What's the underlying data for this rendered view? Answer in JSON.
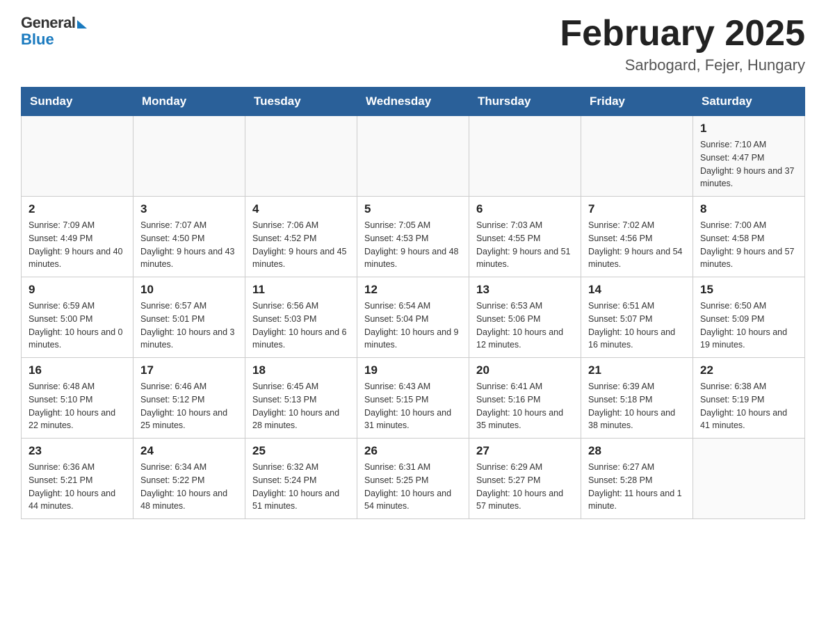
{
  "logo": {
    "general": "General",
    "blue": "Blue"
  },
  "header": {
    "month_year": "February 2025",
    "location": "Sarbogard, Fejer, Hungary"
  },
  "days_of_week": [
    "Sunday",
    "Monday",
    "Tuesday",
    "Wednesday",
    "Thursday",
    "Friday",
    "Saturday"
  ],
  "weeks": [
    [
      {
        "day": "",
        "sunrise": "",
        "sunset": "",
        "daylight": ""
      },
      {
        "day": "",
        "sunrise": "",
        "sunset": "",
        "daylight": ""
      },
      {
        "day": "",
        "sunrise": "",
        "sunset": "",
        "daylight": ""
      },
      {
        "day": "",
        "sunrise": "",
        "sunset": "",
        "daylight": ""
      },
      {
        "day": "",
        "sunrise": "",
        "sunset": "",
        "daylight": ""
      },
      {
        "day": "",
        "sunrise": "",
        "sunset": "",
        "daylight": ""
      },
      {
        "day": "1",
        "sunrise": "Sunrise: 7:10 AM",
        "sunset": "Sunset: 4:47 PM",
        "daylight": "Daylight: 9 hours and 37 minutes."
      }
    ],
    [
      {
        "day": "2",
        "sunrise": "Sunrise: 7:09 AM",
        "sunset": "Sunset: 4:49 PM",
        "daylight": "Daylight: 9 hours and 40 minutes."
      },
      {
        "day": "3",
        "sunrise": "Sunrise: 7:07 AM",
        "sunset": "Sunset: 4:50 PM",
        "daylight": "Daylight: 9 hours and 43 minutes."
      },
      {
        "day": "4",
        "sunrise": "Sunrise: 7:06 AM",
        "sunset": "Sunset: 4:52 PM",
        "daylight": "Daylight: 9 hours and 45 minutes."
      },
      {
        "day": "5",
        "sunrise": "Sunrise: 7:05 AM",
        "sunset": "Sunset: 4:53 PM",
        "daylight": "Daylight: 9 hours and 48 minutes."
      },
      {
        "day": "6",
        "sunrise": "Sunrise: 7:03 AM",
        "sunset": "Sunset: 4:55 PM",
        "daylight": "Daylight: 9 hours and 51 minutes."
      },
      {
        "day": "7",
        "sunrise": "Sunrise: 7:02 AM",
        "sunset": "Sunset: 4:56 PM",
        "daylight": "Daylight: 9 hours and 54 minutes."
      },
      {
        "day": "8",
        "sunrise": "Sunrise: 7:00 AM",
        "sunset": "Sunset: 4:58 PM",
        "daylight": "Daylight: 9 hours and 57 minutes."
      }
    ],
    [
      {
        "day": "9",
        "sunrise": "Sunrise: 6:59 AM",
        "sunset": "Sunset: 5:00 PM",
        "daylight": "Daylight: 10 hours and 0 minutes."
      },
      {
        "day": "10",
        "sunrise": "Sunrise: 6:57 AM",
        "sunset": "Sunset: 5:01 PM",
        "daylight": "Daylight: 10 hours and 3 minutes."
      },
      {
        "day": "11",
        "sunrise": "Sunrise: 6:56 AM",
        "sunset": "Sunset: 5:03 PM",
        "daylight": "Daylight: 10 hours and 6 minutes."
      },
      {
        "day": "12",
        "sunrise": "Sunrise: 6:54 AM",
        "sunset": "Sunset: 5:04 PM",
        "daylight": "Daylight: 10 hours and 9 minutes."
      },
      {
        "day": "13",
        "sunrise": "Sunrise: 6:53 AM",
        "sunset": "Sunset: 5:06 PM",
        "daylight": "Daylight: 10 hours and 12 minutes."
      },
      {
        "day": "14",
        "sunrise": "Sunrise: 6:51 AM",
        "sunset": "Sunset: 5:07 PM",
        "daylight": "Daylight: 10 hours and 16 minutes."
      },
      {
        "day": "15",
        "sunrise": "Sunrise: 6:50 AM",
        "sunset": "Sunset: 5:09 PM",
        "daylight": "Daylight: 10 hours and 19 minutes."
      }
    ],
    [
      {
        "day": "16",
        "sunrise": "Sunrise: 6:48 AM",
        "sunset": "Sunset: 5:10 PM",
        "daylight": "Daylight: 10 hours and 22 minutes."
      },
      {
        "day": "17",
        "sunrise": "Sunrise: 6:46 AM",
        "sunset": "Sunset: 5:12 PM",
        "daylight": "Daylight: 10 hours and 25 minutes."
      },
      {
        "day": "18",
        "sunrise": "Sunrise: 6:45 AM",
        "sunset": "Sunset: 5:13 PM",
        "daylight": "Daylight: 10 hours and 28 minutes."
      },
      {
        "day": "19",
        "sunrise": "Sunrise: 6:43 AM",
        "sunset": "Sunset: 5:15 PM",
        "daylight": "Daylight: 10 hours and 31 minutes."
      },
      {
        "day": "20",
        "sunrise": "Sunrise: 6:41 AM",
        "sunset": "Sunset: 5:16 PM",
        "daylight": "Daylight: 10 hours and 35 minutes."
      },
      {
        "day": "21",
        "sunrise": "Sunrise: 6:39 AM",
        "sunset": "Sunset: 5:18 PM",
        "daylight": "Daylight: 10 hours and 38 minutes."
      },
      {
        "day": "22",
        "sunrise": "Sunrise: 6:38 AM",
        "sunset": "Sunset: 5:19 PM",
        "daylight": "Daylight: 10 hours and 41 minutes."
      }
    ],
    [
      {
        "day": "23",
        "sunrise": "Sunrise: 6:36 AM",
        "sunset": "Sunset: 5:21 PM",
        "daylight": "Daylight: 10 hours and 44 minutes."
      },
      {
        "day": "24",
        "sunrise": "Sunrise: 6:34 AM",
        "sunset": "Sunset: 5:22 PM",
        "daylight": "Daylight: 10 hours and 48 minutes."
      },
      {
        "day": "25",
        "sunrise": "Sunrise: 6:32 AM",
        "sunset": "Sunset: 5:24 PM",
        "daylight": "Daylight: 10 hours and 51 minutes."
      },
      {
        "day": "26",
        "sunrise": "Sunrise: 6:31 AM",
        "sunset": "Sunset: 5:25 PM",
        "daylight": "Daylight: 10 hours and 54 minutes."
      },
      {
        "day": "27",
        "sunrise": "Sunrise: 6:29 AM",
        "sunset": "Sunset: 5:27 PM",
        "daylight": "Daylight: 10 hours and 57 minutes."
      },
      {
        "day": "28",
        "sunrise": "Sunrise: 6:27 AM",
        "sunset": "Sunset: 5:28 PM",
        "daylight": "Daylight: 11 hours and 1 minute."
      },
      {
        "day": "",
        "sunrise": "",
        "sunset": "",
        "daylight": ""
      }
    ]
  ]
}
